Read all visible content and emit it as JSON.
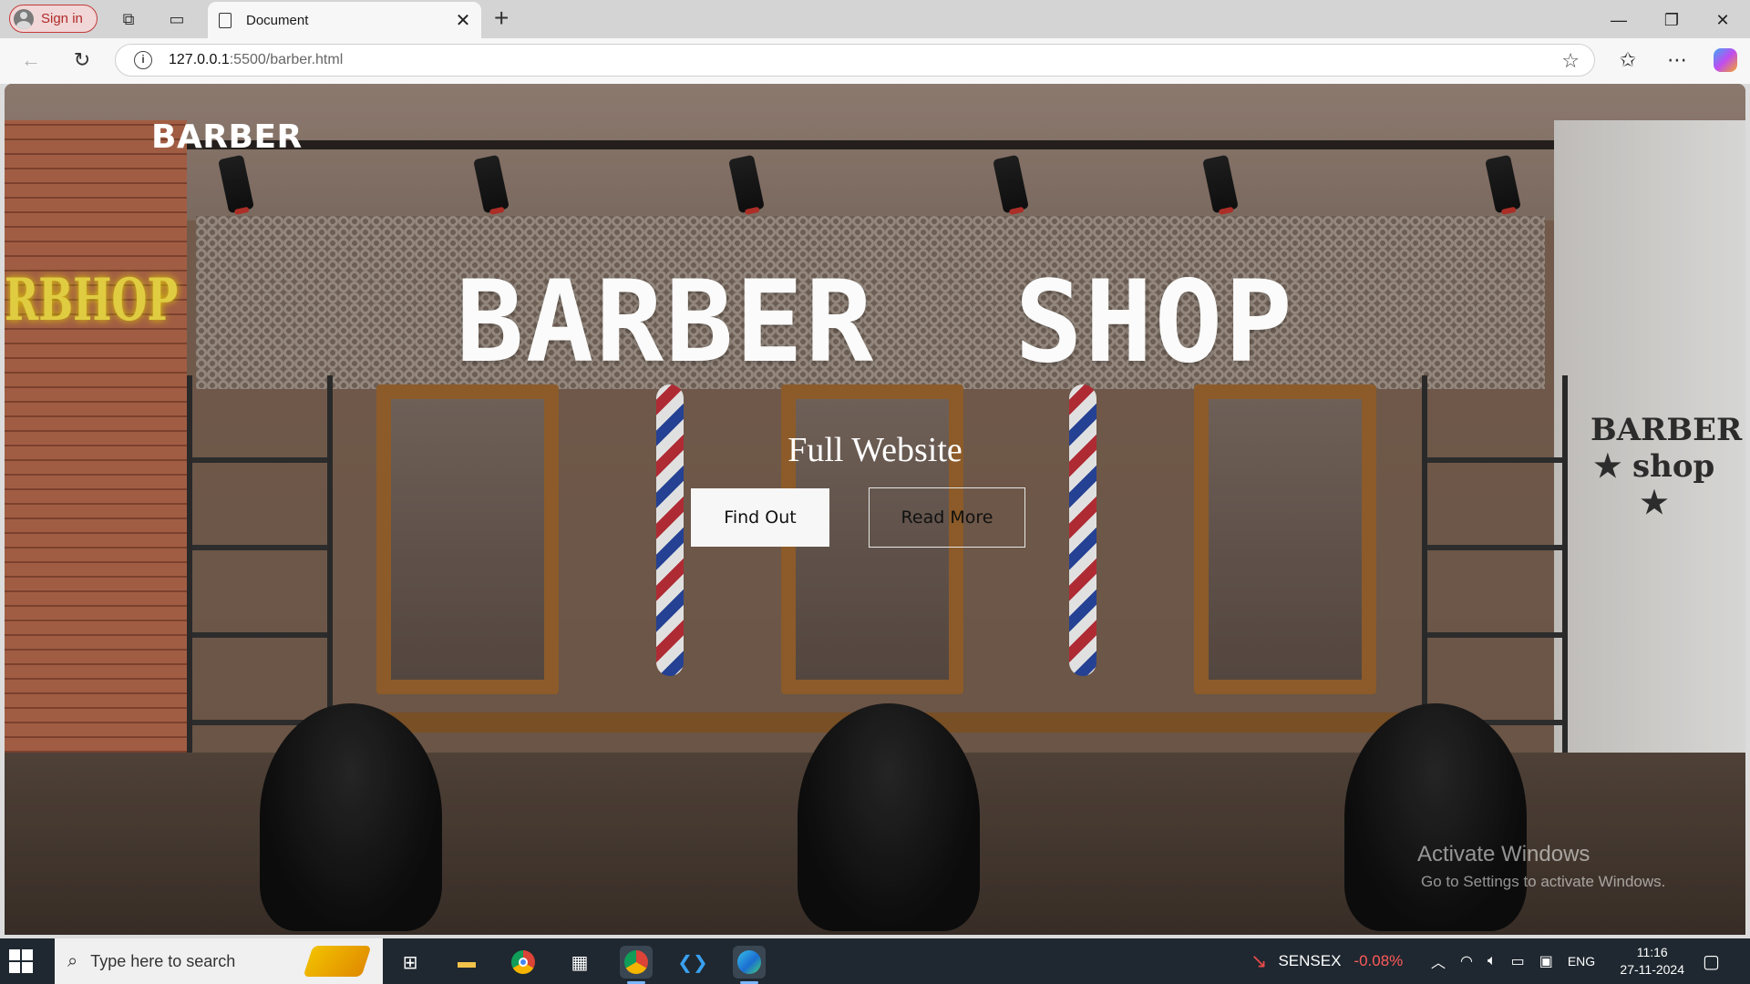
{
  "browser": {
    "signin_label": "Sign in",
    "tab_title": "Document",
    "url_host": "127.0.0.1",
    "url_path": ":5500/barber.html"
  },
  "page": {
    "brand": "BARBER",
    "hero_title": "BARBER  SHOP",
    "hero_subtitle": "Full Website",
    "buttons": {
      "find_out": "Find Out",
      "read_more": "Read More"
    },
    "background_sign_neon": "RBHOP",
    "background_wall_sign": "BARBER ★ shop ★"
  },
  "watermark": {
    "line1": "Activate Windows",
    "line2": "Go to Settings to activate Windows."
  },
  "taskbar": {
    "search_placeholder": "Type here to search",
    "ticker_name": "SENSEX",
    "ticker_value": "-0.08%",
    "language": "ENG",
    "time": "11:16",
    "date": "27-11-2024"
  },
  "colors": {
    "signin_border": "#c23b3b",
    "ticker_negative": "#ff5a5a",
    "taskbar_bg": "#1f2830"
  }
}
